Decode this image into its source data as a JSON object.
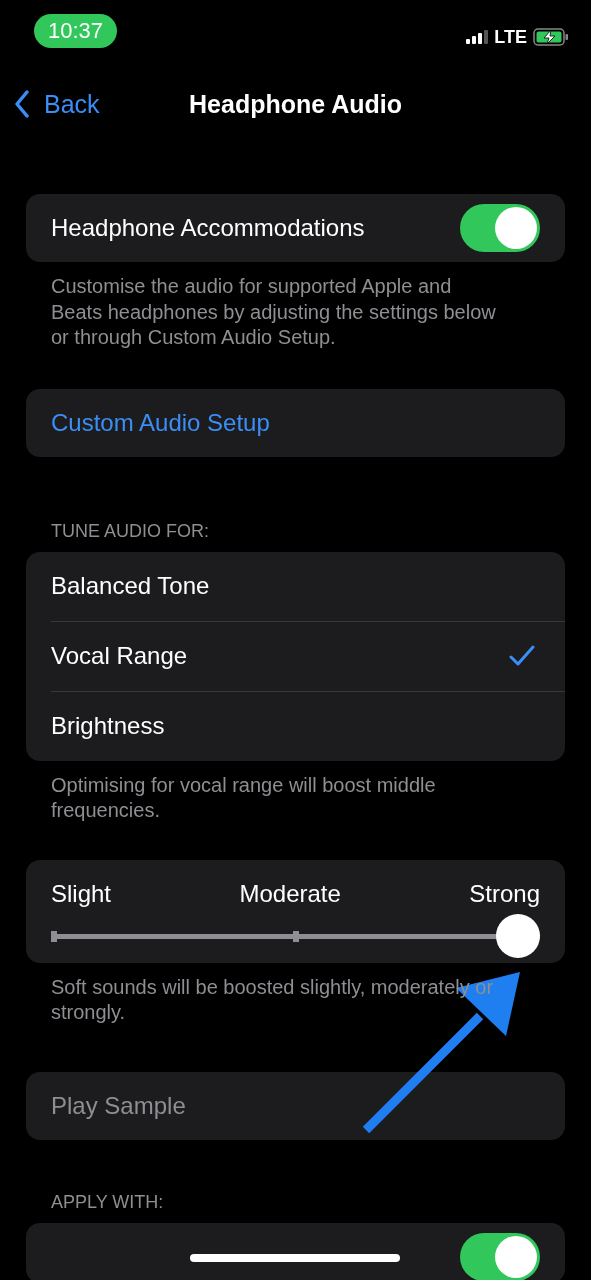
{
  "status_bar": {
    "time": "10:37",
    "network": "LTE"
  },
  "nav": {
    "back": "Back",
    "title": "Headphone Audio"
  },
  "accommodations": {
    "label": "Headphone Accommodations",
    "on": true,
    "footer": "Customise the audio for supported Apple and Beats headphones by adjusting the settings below or through Custom Audio Setup."
  },
  "custom_setup": {
    "label": "Custom Audio Setup"
  },
  "tune": {
    "header": "TUNE AUDIO FOR:",
    "options": [
      {
        "label": "Balanced Tone",
        "selected": false
      },
      {
        "label": "Vocal Range",
        "selected": true
      },
      {
        "label": "Brightness",
        "selected": false
      }
    ],
    "footer": "Optimising for vocal range will boost middle frequencies."
  },
  "strength": {
    "labels": [
      "Slight",
      "Moderate",
      "Strong"
    ],
    "level": 1.0,
    "footer": "Soft sounds will be boosted slightly, moderately or strongly."
  },
  "play_sample": {
    "label": "Play Sample",
    "disabled": true
  },
  "apply_with": {
    "header": "APPLY WITH:",
    "on": true
  }
}
